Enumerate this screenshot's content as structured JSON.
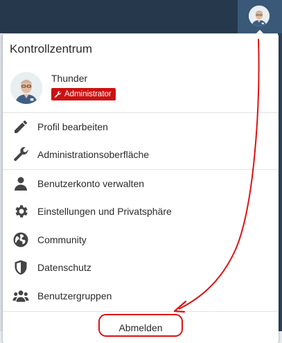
{
  "header": {
    "avatar_name": "user-avatar"
  },
  "dropdown": {
    "title": "Kontrollzentrum",
    "user": {
      "name": "Thunder",
      "role": "Administrator",
      "role_color": "#cc1111"
    },
    "items": [
      {
        "label": "Profil bearbeiten",
        "icon": "pencil-icon"
      },
      {
        "label": "Administrationsoberfläche",
        "icon": "wrench-icon"
      },
      {
        "label": "Benutzerkonto verwalten",
        "icon": "user-icon"
      },
      {
        "label": "Einstellungen und Privatsphäre",
        "icon": "gear-icon"
      },
      {
        "label": "Community",
        "icon": "globe-icon"
      },
      {
        "label": "Datenschutz",
        "icon": "shield-icon"
      },
      {
        "label": "Benutzergruppen",
        "icon": "users-icon"
      }
    ],
    "logout_label": "Abmelden"
  },
  "annotation": {
    "color": "#dd1111"
  },
  "background": {
    "footer_tag": "#1"
  }
}
